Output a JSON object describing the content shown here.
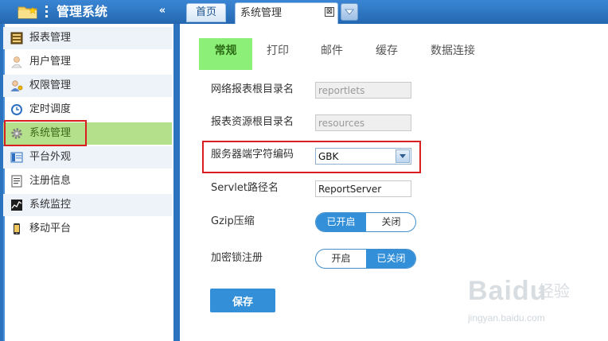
{
  "sidebar": {
    "title": "管理系统",
    "collapse_glyph": "«",
    "items": [
      {
        "label": "报表管理",
        "icon": "report-icon"
      },
      {
        "label": "用户管理",
        "icon": "user-icon"
      },
      {
        "label": "权限管理",
        "icon": "permission-icon"
      },
      {
        "label": "定时调度",
        "icon": "clock-icon"
      },
      {
        "label": "系统管理",
        "icon": "gear-icon",
        "active": true
      },
      {
        "label": "平台外观",
        "icon": "appearance-icon"
      },
      {
        "label": "注册信息",
        "icon": "register-icon"
      },
      {
        "label": "系统监控",
        "icon": "monitor-icon"
      },
      {
        "label": "移动平台",
        "icon": "mobile-icon"
      }
    ]
  },
  "tabs": {
    "home": "首页",
    "current": "系统管理",
    "close_glyph": "⊠"
  },
  "subtabs": [
    {
      "label": "常规",
      "active": true
    },
    {
      "label": "打印"
    },
    {
      "label": "邮件"
    },
    {
      "label": "缓存"
    },
    {
      "label": "数据连接"
    }
  ],
  "form": {
    "report_root": {
      "label": "网络报表根目录名",
      "value": "reportlets"
    },
    "resource_root": {
      "label": "报表资源根目录名",
      "value": "resources"
    },
    "encoding": {
      "label": "服务器端字符编码",
      "value": "GBK"
    },
    "servlet": {
      "label": "Servlet路径名",
      "value": "ReportServer"
    },
    "gzip": {
      "label": "Gzip压缩",
      "on_label": "已开启",
      "off_label": "关闭",
      "state": "on"
    },
    "lock": {
      "label": "加密锁注册",
      "on_label": "开启",
      "off_label": "已关闭",
      "state": "off"
    },
    "save_label": "保存"
  },
  "watermark": {
    "brand": "Bai",
    "brand_tail": "du",
    "cn": "经验",
    "url": "jingyan.baidu.com"
  },
  "colors": {
    "primary": "#3390d8",
    "active_menu": "#b4df8b",
    "active_subtab": "#8cf078",
    "highlight": "#d81e1e"
  }
}
